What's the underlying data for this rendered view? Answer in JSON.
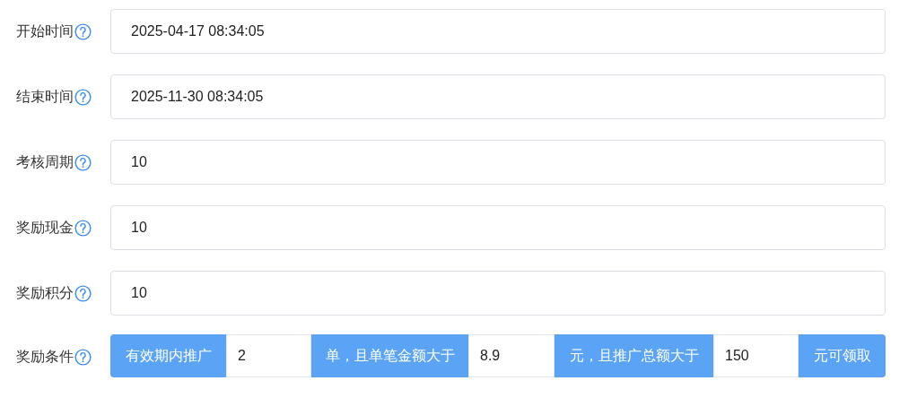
{
  "fields": [
    {
      "label": "开始时间",
      "value": "2025-04-17 08:34:05"
    },
    {
      "label": "结束时间",
      "value": "2025-11-30 08:34:05"
    },
    {
      "label": "考核周期",
      "value": "10"
    },
    {
      "label": "奖励现金",
      "value": "10"
    },
    {
      "label": "奖励积分",
      "value": "10"
    }
  ],
  "condition": {
    "label": "奖励条件",
    "segments": [
      {
        "kind": "addon",
        "text": "有效期内推广"
      },
      {
        "kind": "input",
        "value": "2"
      },
      {
        "kind": "addon",
        "text": "单，且单笔金额大于"
      },
      {
        "kind": "input",
        "value": "8.9"
      },
      {
        "kind": "addon",
        "text": "元，且推广总额大于"
      },
      {
        "kind": "input",
        "value": "150"
      },
      {
        "kind": "addon",
        "text": "元可领取"
      }
    ]
  }
}
